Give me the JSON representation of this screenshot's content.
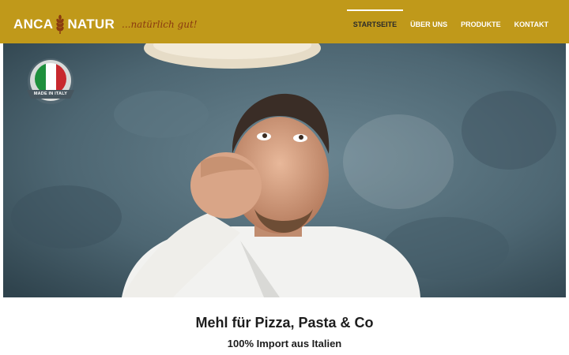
{
  "brand": {
    "name_left": "ANCA",
    "name_right": "NATUR",
    "tagline": "...natürlich gut!"
  },
  "nav": {
    "items": [
      {
        "label": "STARTSEITE",
        "active": true
      },
      {
        "label": "ÜBER UNS",
        "active": false
      },
      {
        "label": "PRODUKTE",
        "active": false
      },
      {
        "label": "KONTAKT",
        "active": false
      }
    ]
  },
  "hero": {
    "badge_text": "MADE IN ITALY"
  },
  "content": {
    "headline": "Mehl für Pizza, Pasta & Co",
    "subline": "100% Import aus Italien"
  },
  "colors": {
    "header_bg": "#c0991a",
    "tagline": "#8a3a10",
    "hero_bg": "#4f6874"
  },
  "icons": [
    "wheat-icon",
    "italy-flag-icon"
  ]
}
